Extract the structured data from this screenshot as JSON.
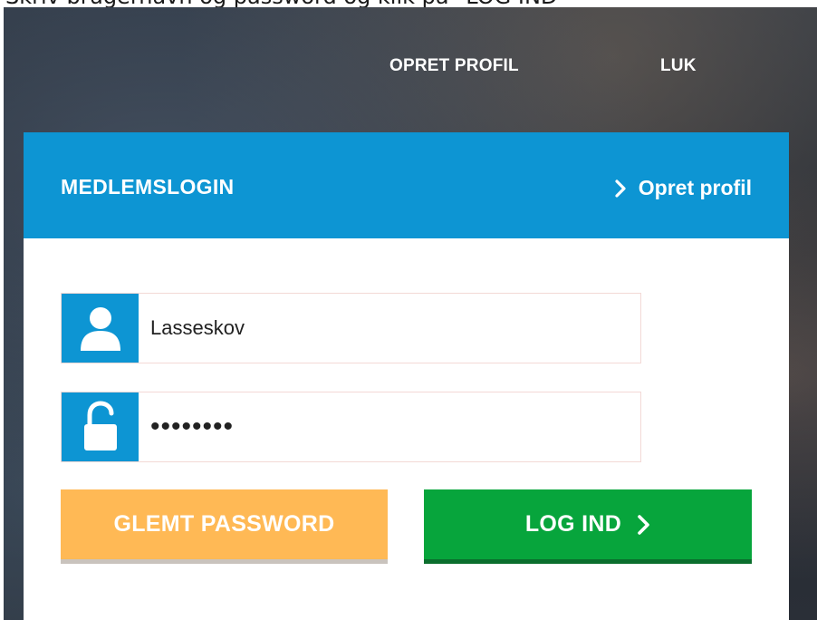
{
  "instruction": "Skriv brugernavn og password og klik på \"LOG IND\"",
  "topnav": {
    "create_profile": "OPRET PROFIL",
    "close": "LUK"
  },
  "panel": {
    "title": "MEDLEMSLOGIN",
    "create_profile_link": "Opret profil",
    "username": {
      "value": "Lasseskov",
      "icon": "user-icon"
    },
    "password": {
      "value": "••••••••",
      "icon": "unlock-icon"
    },
    "forgot_button": "GLEMT PASSWORD",
    "login_button": "LOG IND"
  },
  "colors": {
    "accent_blue": "#0d95d3",
    "forgot_orange": "#ffb955",
    "login_green": "#07a53c"
  }
}
